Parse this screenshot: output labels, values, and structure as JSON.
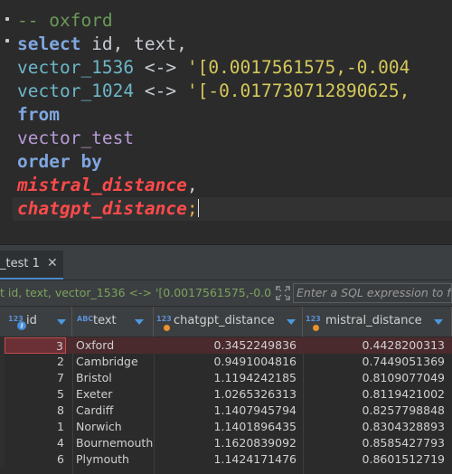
{
  "editor": {
    "comment": "-- oxford",
    "select_kw": "select",
    "select_cols": " id, text,",
    "line3_col": "vector_1536",
    "line3_op": " <-> ",
    "line3_str": "'[0.0017561575,-0.004",
    "line4_col": "vector_1024",
    "line4_op": " <-> ",
    "line4_str": "'[-0.017730712890625,",
    "from_kw": "from",
    "table": "vector_test",
    "order_kw": "order by",
    "order_col1": "mistral_distance",
    "comma": ",",
    "order_col2": "chatgpt_distance",
    "semicolon": ";"
  },
  "results_tab": {
    "label": "_test 1",
    "close": "✕"
  },
  "filter": {
    "query": "t id, text, vector_1536 <-> '[0.0017561575,-0.0",
    "placeholder": "Enter a SQL expression to fi"
  },
  "grid": {
    "columns": [
      {
        "label": "id",
        "type": "123"
      },
      {
        "label": "text",
        "type": "ABC"
      },
      {
        "label": "chatgpt_distance",
        "type": "123"
      },
      {
        "label": "mistral_distance",
        "type": "123"
      }
    ],
    "rows": [
      {
        "id": "3",
        "text": "Oxford",
        "chatgpt": "0.3452249836",
        "mistral": "0.4428200313"
      },
      {
        "id": "2",
        "text": "Cambridge",
        "chatgpt": "0.9491004816",
        "mistral": "0.7449051369"
      },
      {
        "id": "7",
        "text": "Bristol",
        "chatgpt": "1.1194242185",
        "mistral": "0.8109077049"
      },
      {
        "id": "5",
        "text": "Exeter",
        "chatgpt": "1.0265326313",
        "mistral": "0.8119421002"
      },
      {
        "id": "8",
        "text": "Cardiff",
        "chatgpt": "1.1407945794",
        "mistral": "0.8257798848"
      },
      {
        "id": "1",
        "text": "Norwich",
        "chatgpt": "1.1401896435",
        "mistral": "0.8304328893"
      },
      {
        "id": "4",
        "text": "Bournemouth",
        "chatgpt": "1.1620839092",
        "mistral": "0.8585427793"
      },
      {
        "id": "6",
        "text": "Plymouth",
        "chatgpt": "1.1424171476",
        "mistral": "0.8601512719"
      }
    ]
  }
}
